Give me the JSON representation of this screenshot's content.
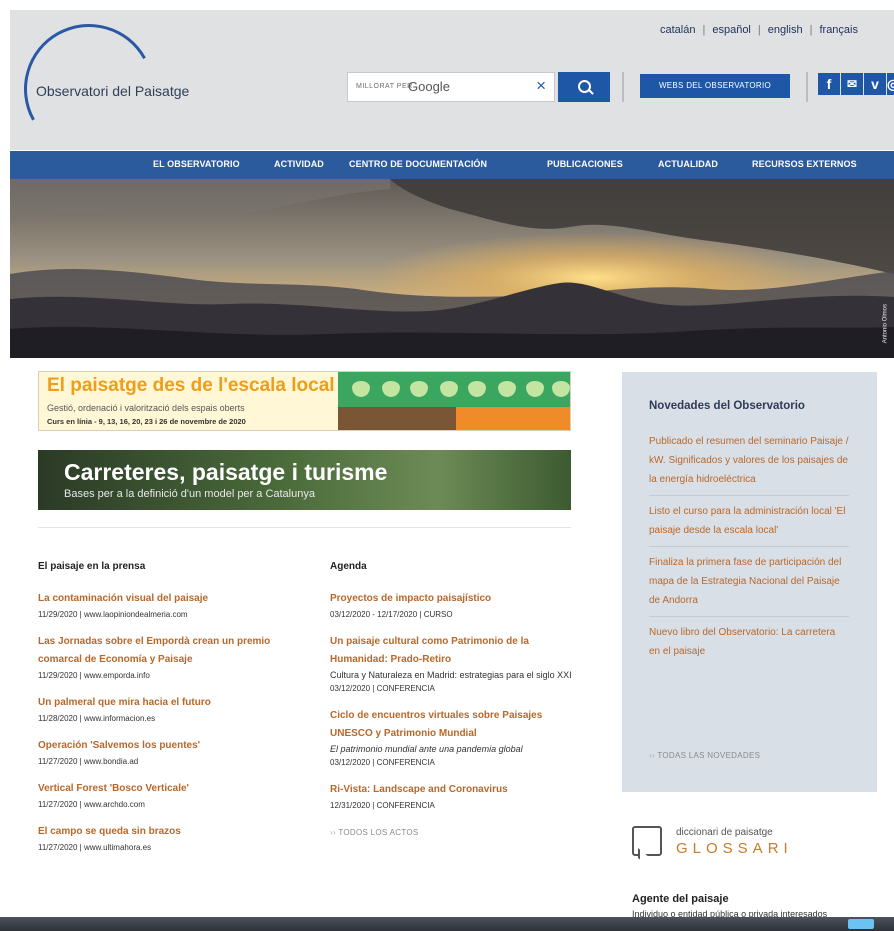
{
  "header": {
    "logo_text": "Observatori del Paisatge",
    "languages": [
      "catalán",
      "español",
      "english",
      "français"
    ],
    "search": {
      "prefix": "MILLORAT PER",
      "engine": "Google",
      "clear_icon": "close-icon",
      "button_icon": "search-icon"
    },
    "webs_button": "WEBS DEL OBSERVATORIO",
    "social": [
      {
        "name": "facebook-icon",
        "glyph": "f"
      },
      {
        "name": "email-icon",
        "glyph": "✉"
      },
      {
        "name": "vimeo-icon",
        "glyph": "v"
      },
      {
        "name": "instagram-icon",
        "glyph": "◎"
      }
    ]
  },
  "nav": {
    "items": [
      "EL OBSERVATORIO",
      "ACTIVIDAD",
      "CENTRO DE DOCUMENTACIÓN",
      "PUBLICACIONES",
      "ACTUALIDAD",
      "RECURSOS EXTERNOS"
    ]
  },
  "hero": {
    "credit": "Antonio Olmos"
  },
  "banners": {
    "local": {
      "title": "El paisatge des de l'escala local",
      "subtitle": "Gestió, ordenació i valorització dels espais oberts",
      "dates": "Curs en línia - 9, 13, 16, 20, 23 i 26 de novembre de 2020"
    },
    "roads": {
      "title": "Carreteres, paisatge i turisme",
      "subtitle": "Bases per a la definició d'un model per a Catalunya"
    }
  },
  "press": {
    "title": "El paisaje en la prensa",
    "items": [
      {
        "title": "La contaminación visual del paisaje",
        "meta": "11/29/2020 | www.laopiniondealmeria.com"
      },
      {
        "title": "Las Jornadas sobre el Empordà crean un premio comarcal de Economía y Paisaje",
        "meta": "11/29/2020 | www.emporda.info"
      },
      {
        "title": "Un palmeral que mira hacia el futuro",
        "meta": "11/28/2020 | www.informacion.es"
      },
      {
        "title": "Operación 'Salvemos los puentes'",
        "meta": "11/27/2020 | www.bondia.ad"
      },
      {
        "title": "Vertical Forest 'Bosco Verticale'",
        "meta": "11/27/2020 | www.archdo.com"
      },
      {
        "title": "El campo se queda sin brazos",
        "meta": "11/27/2020 | www.ultimahora.es"
      }
    ]
  },
  "agenda": {
    "title": "Agenda",
    "items": [
      {
        "title": "Proyectos de impacto paisajístico",
        "desc": "",
        "italic": false,
        "meta": "03/12/2020 - 12/17/2020 | CURSO"
      },
      {
        "title": "Un paisaje cultural como Patrimonio de la Humanidad: Prado-Retiro",
        "desc": "Cultura y Naturaleza en Madrid: estrategias para el siglo XXI",
        "italic": false,
        "meta": "03/12/2020 | CONFERENCIA"
      },
      {
        "title": "Ciclo de encuentros virtuales sobre Paisajes UNESCO y Patrimonio Mundial",
        "desc": "El patrimonio mundial ante una pandemia global",
        "italic": true,
        "meta": "03/12/2020 | CONFERENCIA"
      },
      {
        "title": "Ri-Vista: Landscape and Coronavirus",
        "desc": "",
        "italic": false,
        "meta": "12/31/2020 | CONFERENCIA"
      }
    ],
    "more": "TODOS LOS ACTOS"
  },
  "sidebar": {
    "title": "Novedades del Observatorio",
    "items": [
      "Publicado el resumen del seminario Paisaje / kW. Significados y valores de los paisajes de la energía hidroeléctrica",
      "Listo el curso para la administración local 'El paisaje desde la escala local'",
      "Finaliza la primera fase de participación del mapa de la Estrategia Nacional del Paisaje de Andorra",
      "Nuevo libro del Observatorio: La carretera en el paisaje"
    ],
    "more": "TODAS LAS NOVEDADES"
  },
  "glossary": {
    "small": "diccionari de paisatge",
    "big": "GLOSSARI"
  },
  "agente": {
    "title": "Agente del paisaje",
    "desc": "Individuo o entidad pública o privada interesados"
  },
  "colors": {
    "brand_blue": "#1f57a7",
    "accent_orange": "#b8682a",
    "nav_blue": "#2b5a9d"
  }
}
